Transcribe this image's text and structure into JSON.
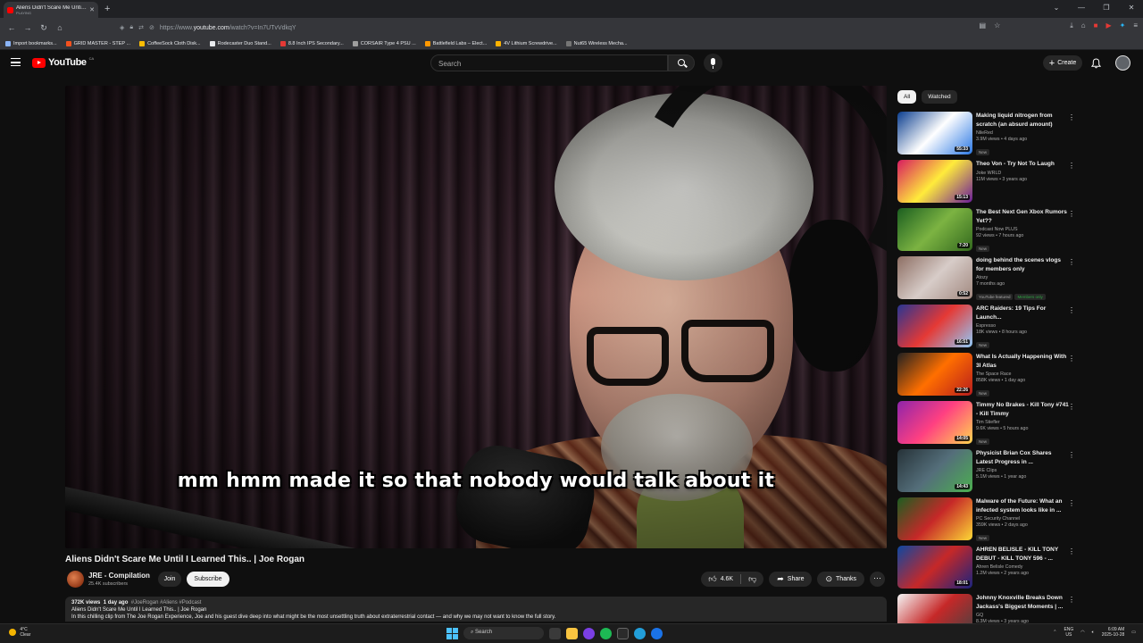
{
  "browser": {
    "tab_title": "Aliens Didn't Scare Me Until I L",
    "tab_status": "PLAYING",
    "url_prefix": "https://www.",
    "url_host": "youtube.com",
    "url_path": "/watch?v=In7UTvVdkqY",
    "bookmarks": [
      "Import bookmarks...",
      "GRID MASTER - STEP ...",
      "CoffeeSock Cloth Disk...",
      "Rodecaster Duo Stand...",
      "8.8 Inch IPS Secondary...",
      "CORSAIR Type 4 PSU ...",
      "Battlefield Labs – Elect...",
      "4V Lithium Screwdrive...",
      "Nut65 Wireless Mecha..."
    ]
  },
  "header": {
    "logo_text": "YouTube",
    "country": "CA",
    "search_placeholder": "Search",
    "create_label": "Create"
  },
  "player": {
    "caption": "mm hmm made it so that nobody would talk about it"
  },
  "video": {
    "title": "Aliens Didn't Scare Me Until I Learned This.. | Joe Rogan",
    "channel": "JRE - Compilation",
    "subscribers": "25.4K subscribers",
    "join_label": "Join",
    "subscribe_label": "Subscribe",
    "likes": "4.6K",
    "share_label": "Share",
    "thanks_label": "Thanks",
    "views": "372K views",
    "age": "1 day ago",
    "tags": "#JoeRogan #Aliens #Podcast",
    "desc_line1": "Aliens Didn't Scare Me Until I Learned This.. | Joe Rogan",
    "desc_line2": "In this chilling clip from The Joe Rogan Experience, Joe and his guest dive deep into what might be the most unsettling truth about extraterrestrial contact — and why we may not want to know the full story."
  },
  "sidebar": {
    "chips": [
      "All",
      "Watched"
    ],
    "recommendations": [
      {
        "title": "Making liquid nitrogen from scratch (an absurd amount)",
        "channel": "NileRed",
        "views": "3.9M views • 4 days ago",
        "badge": "New",
        "duration": "55:33",
        "colors": [
          "#0a3d8f",
          "#ffffff",
          "#2b78e4"
        ]
      },
      {
        "title": "Theo Von - Try Not To Laugh",
        "channel": "Joke WRLD",
        "views": "11M views • 3 years ago",
        "badge": "",
        "duration": "15:13",
        "colors": [
          "#d81b60",
          "#ffeb3b",
          "#6a1b9a"
        ]
      },
      {
        "title": "The Best Next Gen Xbox Rumors Yet??",
        "channel": "Podcast Now PLUS",
        "views": "92 views • 7 hours ago",
        "badge": "New",
        "duration": "7:20",
        "colors": [
          "#1b5e20",
          "#7cb342",
          "#33691e"
        ]
      },
      {
        "title": "doing behind the scenes vlogs for members only",
        "channel": "Atozy",
        "views": "7 months ago",
        "badge": "YouTube featured",
        "badge2": "Members only",
        "duration": "0:52",
        "colors": [
          "#8d6e63",
          "#d7ccc8",
          "#a1887f"
        ]
      },
      {
        "title": "ARC Raiders: 19 Tips For Launch...",
        "channel": "Espresso",
        "views": "18K views • 8 hours ago",
        "badge": "New",
        "duration": "16:51",
        "colors": [
          "#283593",
          "#e53935",
          "#90caf9"
        ]
      },
      {
        "title": "What Is Actually Happening With 3I Atlas",
        "channel": "The Space Race",
        "views": "858K views • 1 day ago",
        "badge": "New",
        "duration": "22:26",
        "colors": [
          "#212121",
          "#ff6f00",
          "#b71c1c"
        ]
      },
      {
        "title": "Timmy No Brakes - Kill Tony #741 - Kill Timmy",
        "channel": "Tim Stiefler",
        "views": "9.6K views • 5 hours ago",
        "badge": "New",
        "duration": "14:05",
        "colors": [
          "#8e24aa",
          "#ff4081",
          "#ffd54f"
        ]
      },
      {
        "title": "Physicist Brian Cox Shares Latest Progress in ...",
        "channel": "JRE Clips",
        "views": "5.1M views • 1 year ago",
        "badge": "",
        "duration": "14:43",
        "colors": [
          "#263238",
          "#546e7a",
          "#4caf50"
        ]
      },
      {
        "title": "Malware of the Future: What an infected system looks like in ...",
        "channel": "PC Security Channel",
        "views": "359K views • 2 days ago",
        "badge": "New",
        "duration": "",
        "colors": [
          "#1b5e20",
          "#c62828",
          "#fdd835"
        ]
      },
      {
        "title": "AHREN BELISLE - KILL TONY DEBUT - KILL TONY 596 - ...",
        "channel": "Ahren Belisle Comedy",
        "views": "1.2M views • 2 years ago",
        "badge": "",
        "duration": "18:01",
        "colors": [
          "#0d47a1",
          "#c62828",
          "#1a237e"
        ]
      },
      {
        "title": "Johnny Knoxville Breaks Down Jackass's Biggest Moments | ...",
        "channel": "GQ",
        "views": "8.3M views • 3 years ago",
        "badge": "",
        "duration": "",
        "colors": [
          "#f5f5f5",
          "#c62828",
          "#424242"
        ]
      }
    ]
  },
  "taskbar": {
    "temp": "4°C",
    "weather": "Clear",
    "search_label": "Search",
    "lang1": "ENG",
    "lang2": "US",
    "time": "6:09 AM",
    "date": "2025-10-28"
  }
}
